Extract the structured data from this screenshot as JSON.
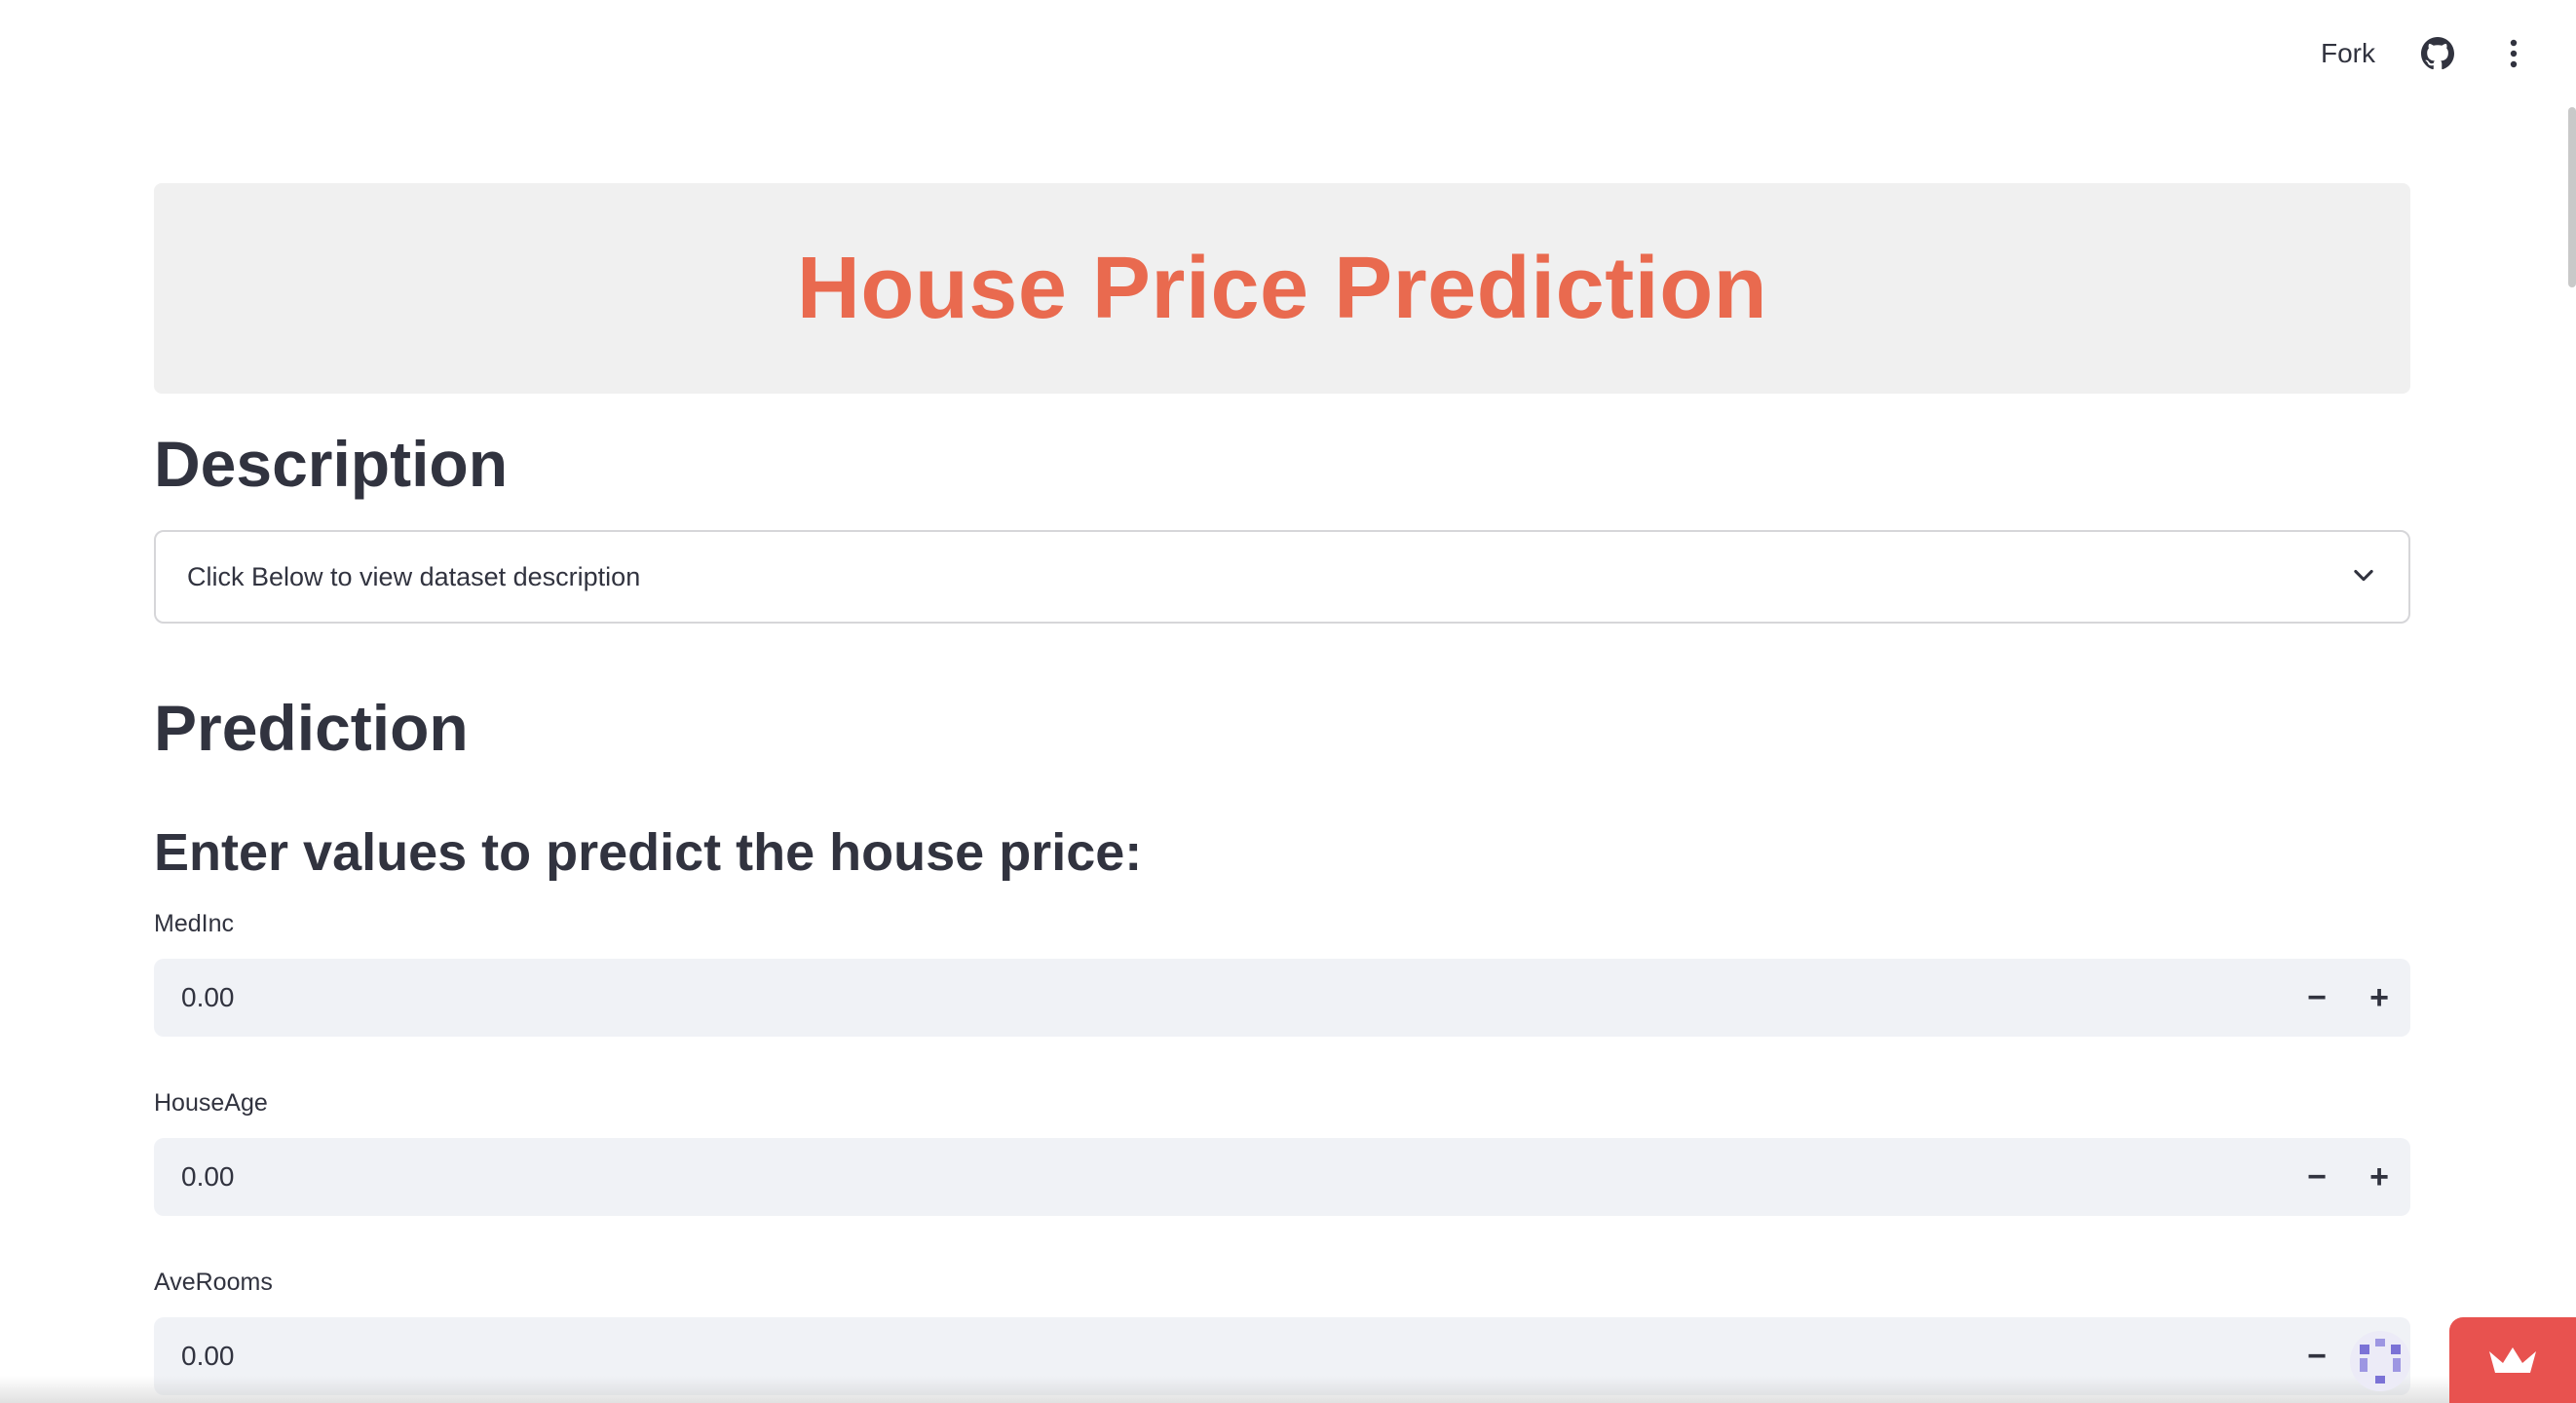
{
  "toolbar": {
    "fork_label": "Fork",
    "github_icon": "github-icon",
    "menu_icon": "kebab-menu-icon"
  },
  "header": {
    "title": "House Price Prediction",
    "title_color": "#e96a4f"
  },
  "description": {
    "heading": "Description",
    "expander_label": "Click Below to view dataset description",
    "expander_icon": "chevron-down-icon"
  },
  "prediction": {
    "heading": "Prediction",
    "subheading": "Enter values to predict the house price:",
    "fields": [
      {
        "label": "MedInc",
        "value": "0.00"
      },
      {
        "label": "HouseAge",
        "value": "0.00"
      },
      {
        "label": "AveRooms",
        "value": "0.00"
      }
    ],
    "decrement_symbol": "−",
    "increment_symbol": "+"
  },
  "badge": {
    "icon": "streamlit-crown-icon",
    "color": "#e8524f"
  }
}
